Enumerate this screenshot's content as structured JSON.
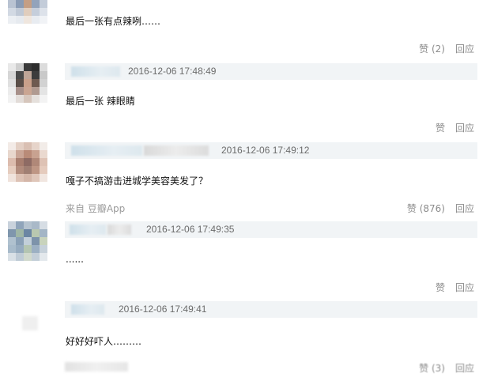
{
  "comments": [
    {
      "body": "最后一张有点辣咧……",
      "like_label": "赞",
      "like_count": "(2)",
      "reply_label": "回应"
    },
    {
      "timestamp": "2016-12-06 17:48:49",
      "body": "最后一张 辣眼睛",
      "like_label": "赞",
      "reply_label": "回应"
    },
    {
      "timestamp": "2016-12-06 17:49:12",
      "body": "嘎子不搞游击进城学美容美发了？",
      "source": "来自 豆瓣App",
      "like_label": "赞",
      "like_count": "(876)",
      "reply_label": "回应"
    },
    {
      "timestamp": "2016-12-06 17:49:35",
      "body": "......",
      "like_label": "赞",
      "reply_label": "回应"
    },
    {
      "timestamp": "2016-12-06 17:49:41",
      "body": "好好好吓人………",
      "like_label": "赞",
      "like_count": "(3)",
      "reply_label": "回应"
    }
  ]
}
